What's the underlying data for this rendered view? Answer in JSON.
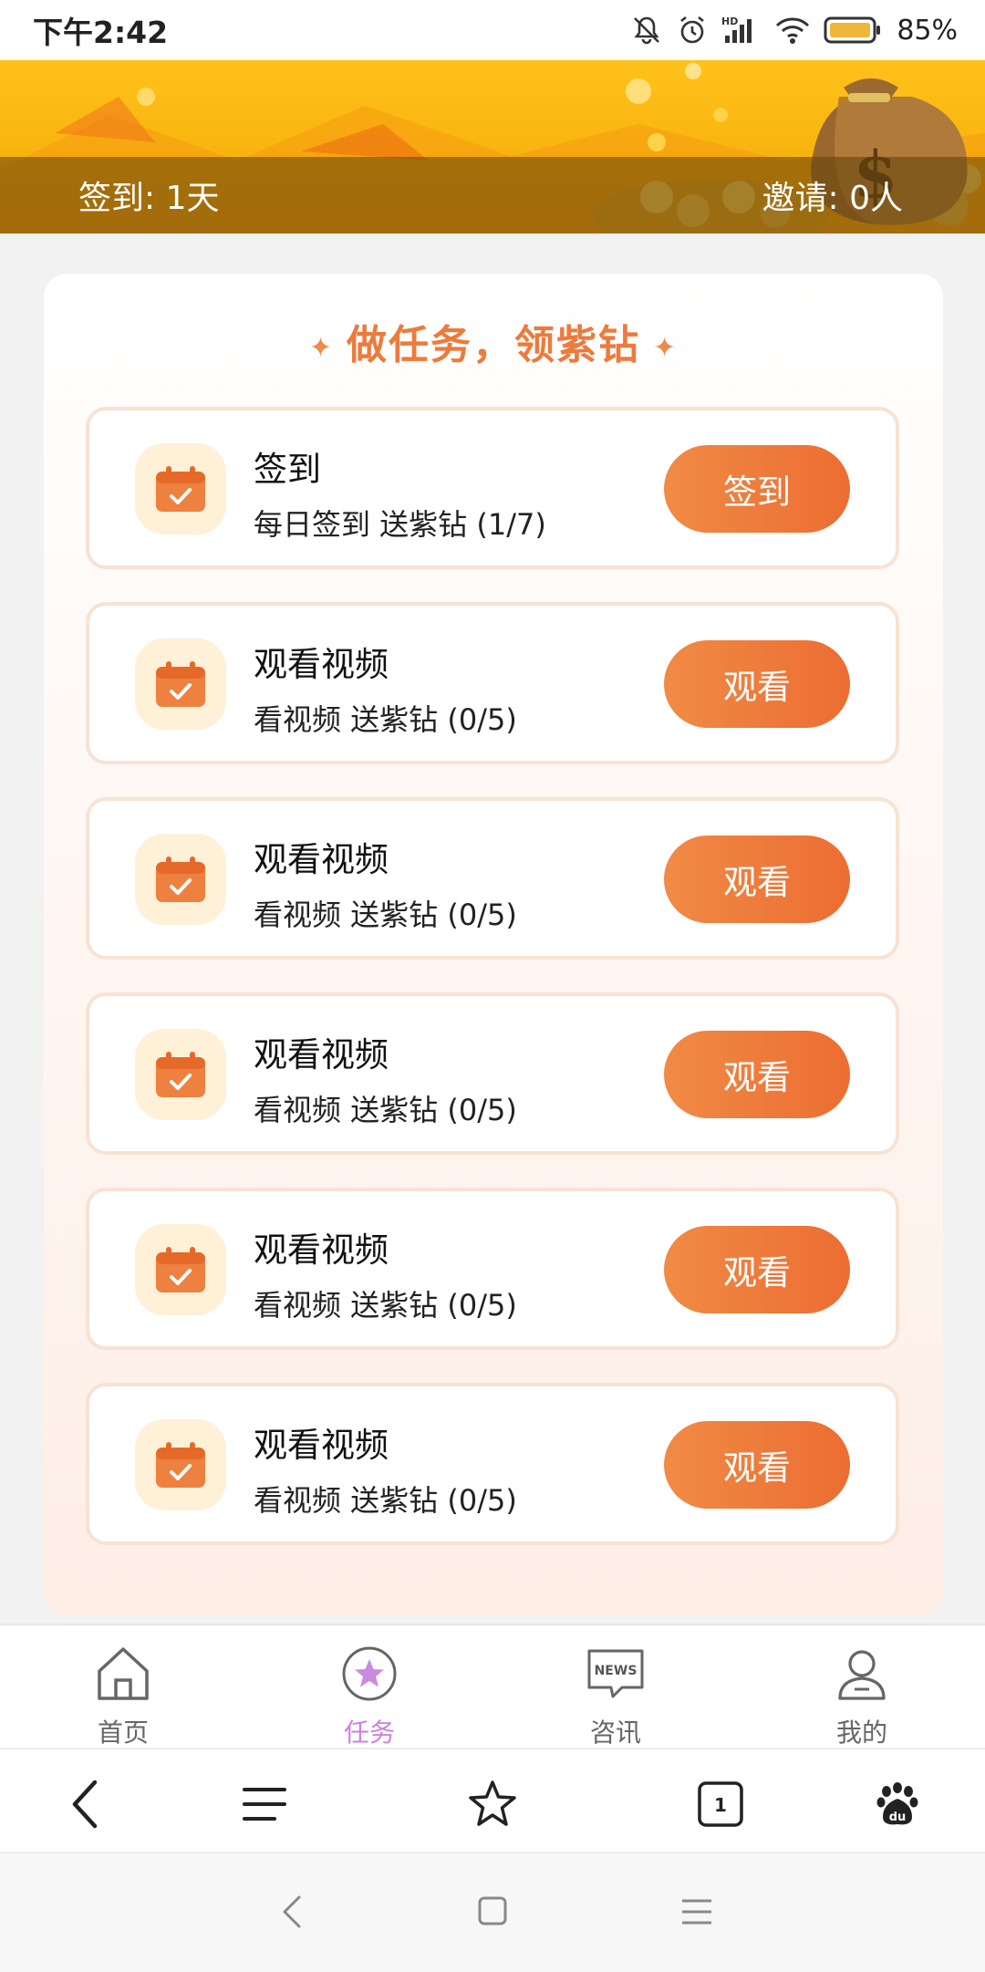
{
  "status_bar": {
    "time": "下午2:42",
    "battery": "85%",
    "icons": [
      "mute-icon",
      "alarm-icon",
      "hd-signal-icon",
      "wifi-icon",
      "battery-icon"
    ]
  },
  "banner": {
    "checkin_text": "签到:  1天",
    "invite_text": "邀请:  0人"
  },
  "tasks_section": {
    "heading": "做任务，领紫钻",
    "items": [
      {
        "title": "签到",
        "desc": "每日签到 送紫钻 (1/7)",
        "button": "签到"
      },
      {
        "title": "观看视频",
        "desc": "看视频 送紫钻 (0/5)",
        "button": "观看"
      },
      {
        "title": "观看视频",
        "desc": "看视频 送紫钻 (0/5)",
        "button": "观看"
      },
      {
        "title": "观看视频",
        "desc": "看视频 送紫钻 (0/5)",
        "button": "观看"
      },
      {
        "title": "观看视频",
        "desc": "看视频 送紫钻 (0/5)",
        "button": "观看"
      },
      {
        "title": "观看视频",
        "desc": "看视频 送紫钻 (0/5)",
        "button": "观看"
      }
    ]
  },
  "app_nav": {
    "items": [
      {
        "label": "首页",
        "icon": "home-icon"
      },
      {
        "label": "任务",
        "icon": "star-badge-icon",
        "active": true
      },
      {
        "label": "咨讯",
        "icon": "news-icon",
        "badge": "NEWS"
      },
      {
        "label": "我的",
        "icon": "user-icon"
      }
    ]
  },
  "browser_bar": {
    "tab_count": "1",
    "icons": [
      "back-icon",
      "menu-icon",
      "favorite-star-icon",
      "tabs-icon",
      "baidu-paw-icon"
    ]
  },
  "system_nav": {
    "icons": [
      "nav-back-icon",
      "nav-home-icon",
      "nav-recents-icon"
    ]
  },
  "colors": {
    "accent_orange": "#ec6d32",
    "heading_orange": "#ec7b3c",
    "active_tab": "#cf7fe0",
    "banner_yellow": "#ffc21a"
  }
}
